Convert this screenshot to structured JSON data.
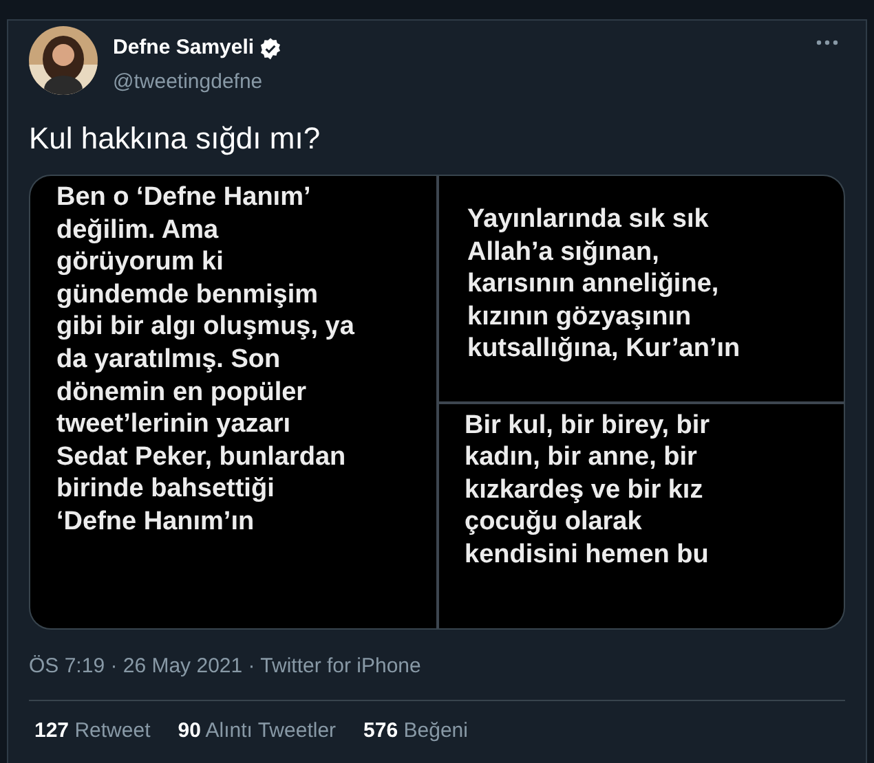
{
  "author": {
    "name": "Defne Samyeli",
    "handle": "@tweetingdefne",
    "verified": true
  },
  "tweet_text": "Kul hakkına sığdı mı?",
  "images": [
    {
      "lines": [
        "Ben o ‘Defne Hanım’",
        "değilim. Ama",
        "görüyorum ki",
        "gündemde benmişim",
        "gibi bir algı oluşmuş, ya",
        "da yaratılmış. Son",
        "dönemin en popüler",
        "tweet’lerinin yazarı",
        "Sedat Peker, bunlardan",
        "birinde bahsettiği",
        "‘Defne Hanım’ın"
      ]
    },
    {
      "lines": [
        "Yayınlarında sık sık",
        "Allah’a sığınan,",
        "karısının anneliğine,",
        "kızının gözyaşının",
        "kutsallığına, Kur’an’ın"
      ]
    },
    {
      "lines": [
        "Bir kul, bir birey, bir",
        "kadın, bir anne, bir",
        "kızkardeş ve bir kız",
        "çocuğu olarak",
        "kendisini hemen bu"
      ]
    }
  ],
  "meta": "ÖS 7:19 · 26 May 2021 · Twitter for iPhone",
  "stats": [
    {
      "count": "127",
      "label": "Retweet"
    },
    {
      "count": "90",
      "label": "Alıntı Tweetler"
    },
    {
      "count": "576",
      "label": "Beğeni"
    }
  ]
}
